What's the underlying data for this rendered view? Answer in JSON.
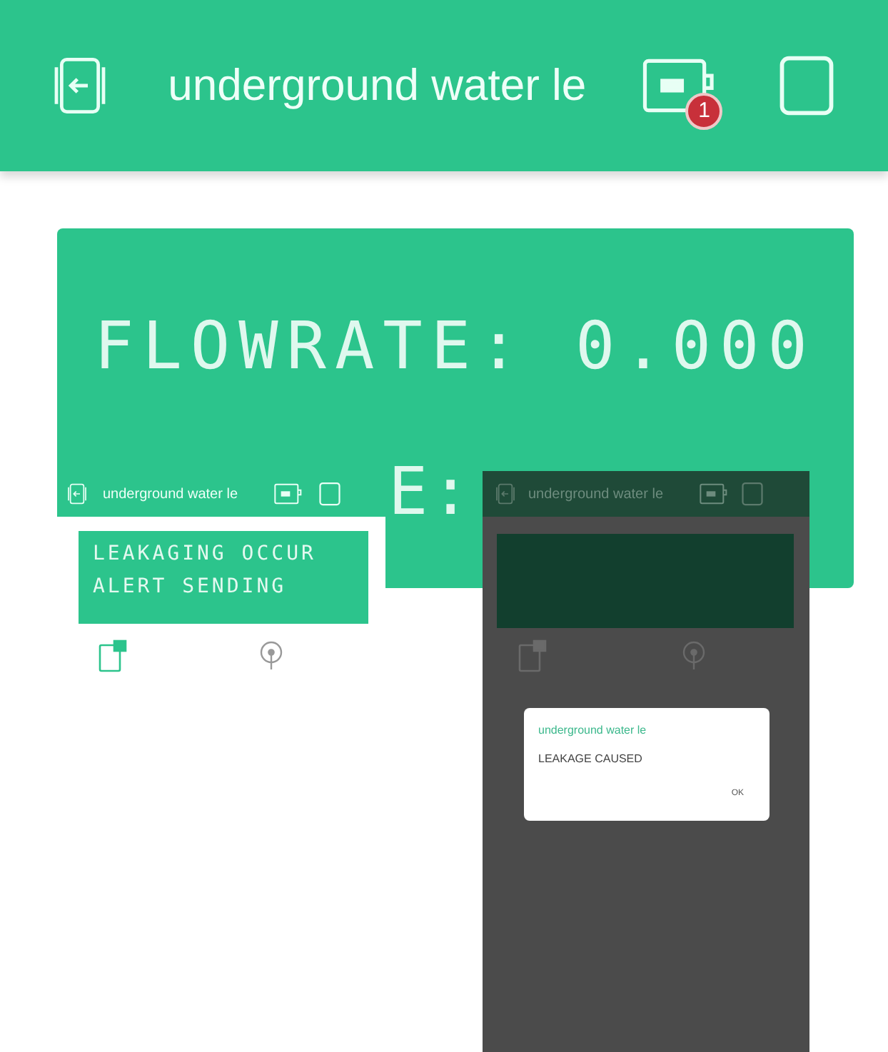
{
  "header": {
    "title": "underground water le",
    "badge": "1"
  },
  "lcd": {
    "lines": [
      "FLOWRATE: 0.000",
      "E:"
    ]
  },
  "inset_app": {
    "title": "underground water le",
    "lcd_lines": [
      "LEAKAGING OCCUR",
      "ALERT SENDING"
    ]
  },
  "dimmed_app": {
    "title": "underground water le",
    "dialog": {
      "title": "underground water le",
      "message": "LEAKAGE CAUSED",
      "button": "OK"
    }
  }
}
